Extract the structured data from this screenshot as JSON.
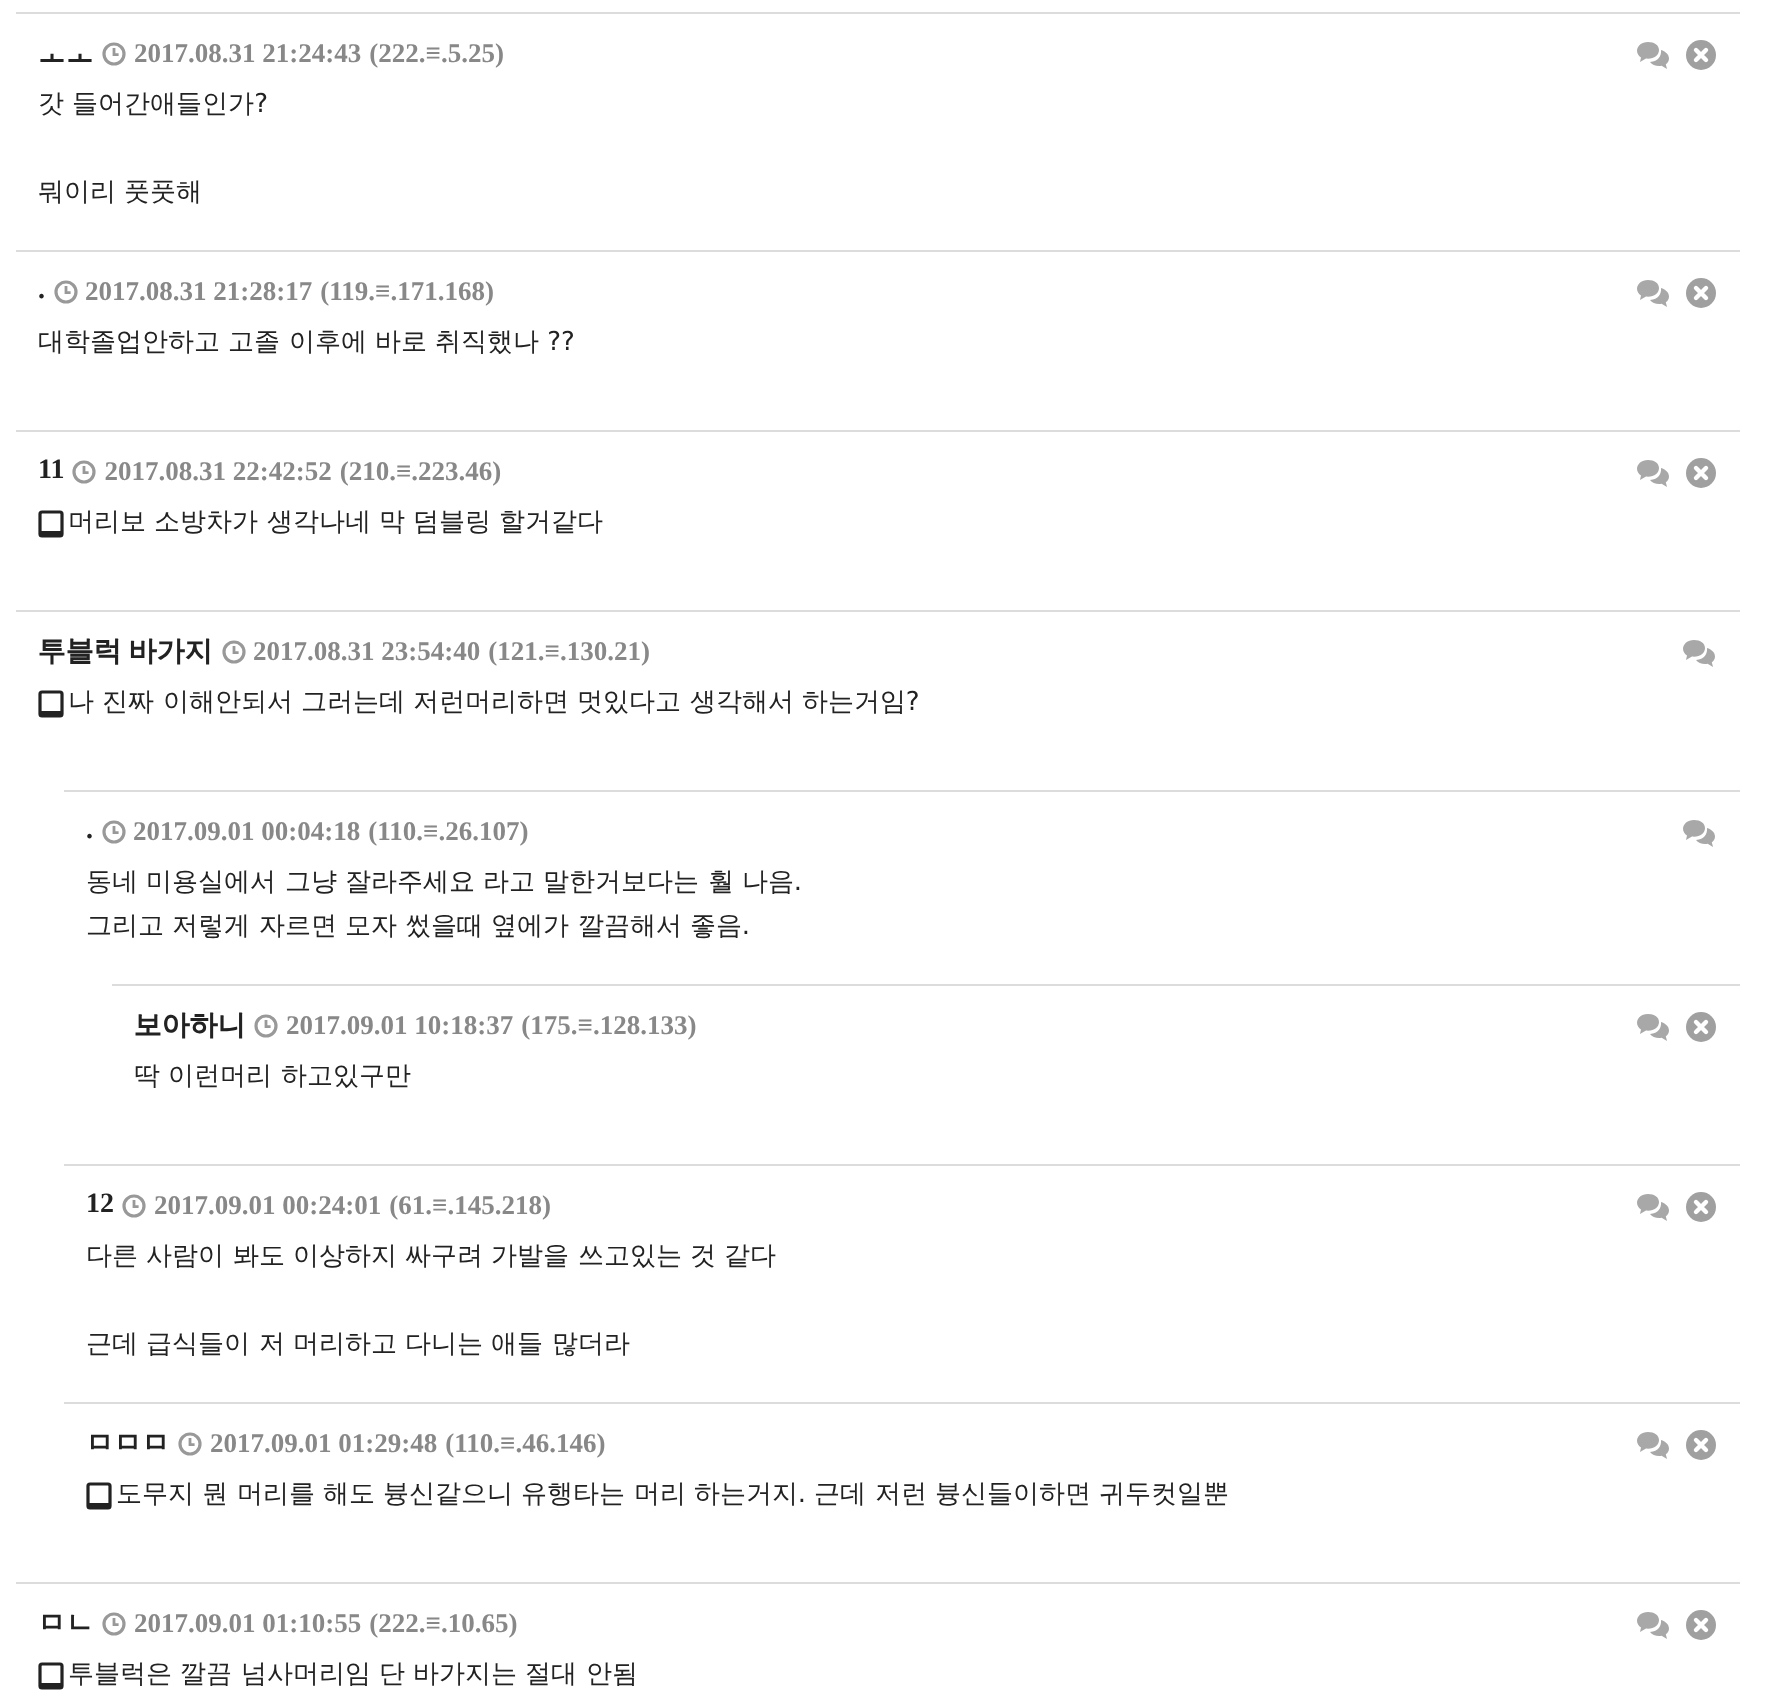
{
  "comments": [
    {
      "author": "ㅗㅗ",
      "time": "2017.08.31 21:24:43",
      "ip": "(222.≡.5.25)",
      "mobile": false,
      "deletable": true,
      "paragraphs": [
        "갓 들어간애들인가?",
        "뭐이리 풋풋해"
      ]
    },
    {
      "author": ".",
      "time": "2017.08.31 21:28:17",
      "ip": "(119.≡.171.168)",
      "mobile": false,
      "deletable": true,
      "paragraphs": [
        "대학졸업안하고 고졸 이후에 바로 취직했나 ??"
      ]
    },
    {
      "author": "11",
      "time": "2017.08.31 22:42:52",
      "ip": "(210.≡.223.46)",
      "mobile": true,
      "deletable": true,
      "paragraphs": [
        "머리보  소방차가  생각나네  막  덤블링  할거같다"
      ]
    },
    {
      "author": "투블럭 바가지",
      "time": "2017.08.31 23:54:40",
      "ip": "(121.≡.130.21)",
      "mobile": true,
      "deletable": false,
      "paragraphs": [
        "나 진짜 이해안되서 그러는데 저런머리하면 멋있다고 생각해서 하는거임?"
      ],
      "children": [
        {
          "author": ".",
          "time": "2017.09.01 00:04:18",
          "ip": "(110.≡.26.107)",
          "mobile": false,
          "deletable": false,
          "paragraphs": [
            "동네 미용실에서 그냥 잘라주세요 라고 말한거보다는 훨 나음.\n그리고 저렇게 자르면 모자 썼을때 옆에가 깔끔해서 좋음."
          ],
          "children": [
            {
              "author": "보아하니",
              "time": "2017.09.01 10:18:37",
              "ip": "(175.≡.128.133)",
              "mobile": false,
              "deletable": true,
              "paragraphs": [
                "딱 이런머리 하고있구만"
              ]
            }
          ]
        },
        {
          "author": "12",
          "time": "2017.09.01 00:24:01",
          "ip": "(61.≡.145.218)",
          "mobile": false,
          "deletable": true,
          "paragraphs": [
            "다른 사람이 봐도 이상하지  싸구려 가발을 쓰고있는 것 같다",
            "근데 급식들이 저 머리하고 다니는 애들 많더라"
          ]
        },
        {
          "author": "ㅁㅁㅁ",
          "time": "2017.09.01 01:29:48",
          "ip": "(110.≡.46.146)",
          "mobile": true,
          "deletable": true,
          "paragraphs": [
            "도무지 뭔 머리를 해도 븅신같으니 유행타는 머리 하는거지. 근데 저런 븅신들이하면 귀두컷일뿐"
          ]
        }
      ]
    },
    {
      "author": "ㅁㄴ",
      "time": "2017.09.01 01:10:55",
      "ip": "(222.≡.10.65)",
      "mobile": true,
      "deletable": true,
      "paragraphs": [
        "투블럭은 깔끔 넘사머리임 단 바가지는 절대 안됨"
      ]
    }
  ]
}
